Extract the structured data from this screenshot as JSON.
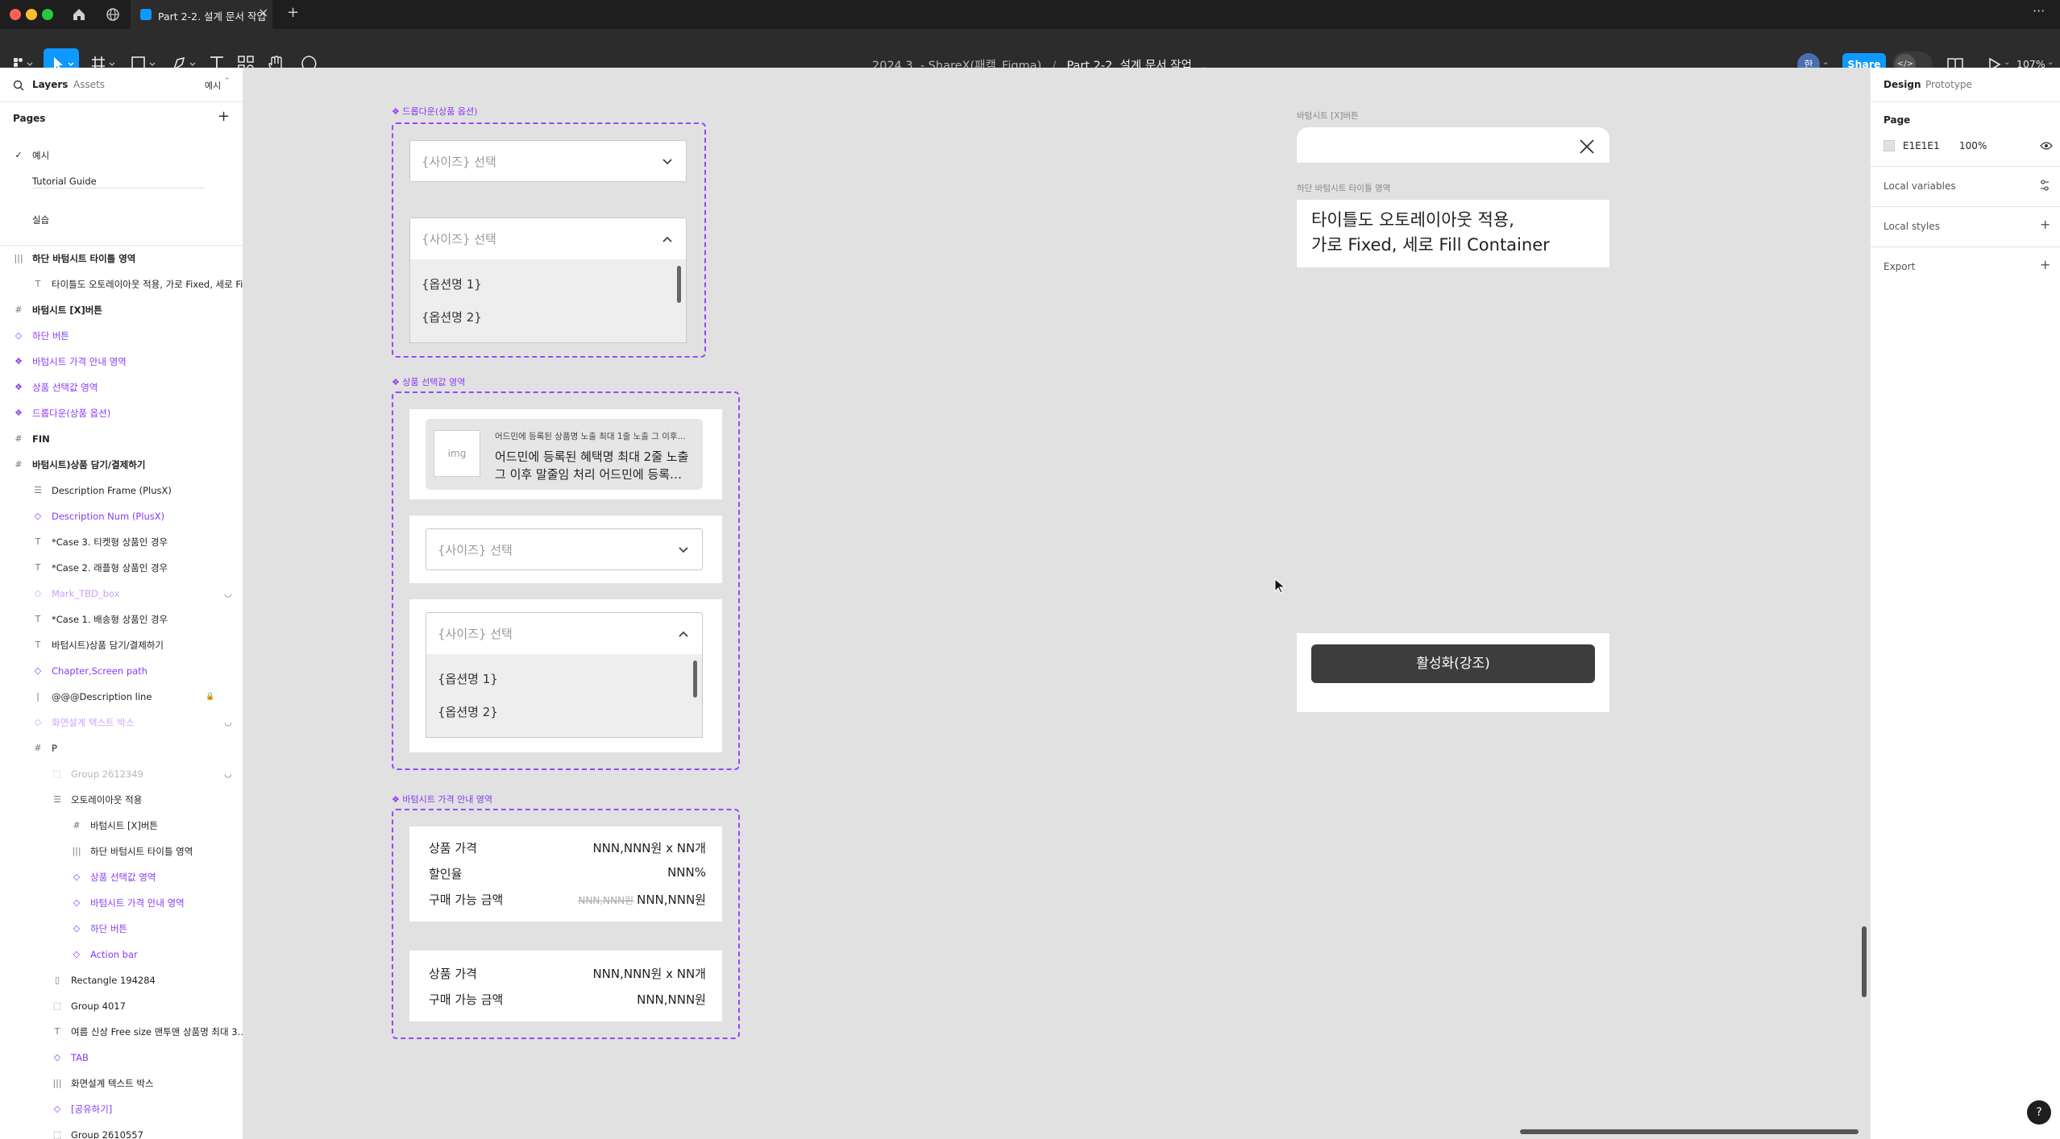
{
  "tabbar": {
    "tab_title": "Part 2-2. 설계 문서 작업",
    "more": "···"
  },
  "toolbar": {
    "breadcrumb_team": "2024.3. - ShareX(패캠_Figma)",
    "breadcrumb_sep": "/",
    "file_name": "Part 2-2. 설계 문서 작업",
    "avatar_initial": "한",
    "share_label": "Share",
    "zoom": "107%"
  },
  "left_panel": {
    "tabs": [
      "Layers",
      "Assets"
    ],
    "page_selector": "예시",
    "pages_title": "Pages",
    "pages": [
      {
        "label": "예시",
        "current": true
      },
      {
        "label": "Tutorial Guide",
        "current": false
      },
      {
        "label": "실습",
        "current": false
      }
    ],
    "layers": [
      {
        "label": "하단 바텀시트 타이틀 영역",
        "icon": "|||",
        "indent": 0,
        "style": "bold"
      },
      {
        "label": "타이틀도 오토레이아웃 적용, 가로 Fixed, 세로 Fil...",
        "icon": "T",
        "indent": 1,
        "style": ""
      },
      {
        "label": "바텀시트 [X]버튼",
        "icon": "#",
        "indent": 0,
        "style": "bold"
      },
      {
        "label": "하단 버튼",
        "icon": "◇",
        "indent": 0,
        "style": "purple"
      },
      {
        "label": "바텀시트 가격 안내 영역",
        "icon": "❖",
        "indent": 0,
        "style": "purple"
      },
      {
        "label": "상품 선택값 영역",
        "icon": "❖",
        "indent": 0,
        "style": "purple"
      },
      {
        "label": "드롭다운(상품 옵션)",
        "icon": "❖",
        "indent": 0,
        "style": "purple"
      },
      {
        "label": "FIN",
        "icon": "#",
        "indent": 0,
        "style": "bold"
      },
      {
        "label": "바텀시트)상품 담기/결제하기",
        "icon": "#",
        "indent": 0,
        "style": "bold"
      },
      {
        "label": "Description Frame (PlusX)",
        "icon": "☰",
        "indent": 1,
        "style": ""
      },
      {
        "label": "Description Num (PlusX)",
        "icon": "◇",
        "indent": 1,
        "style": "purple"
      },
      {
        "label": "*Case 3. 티켓형 상품인 경우",
        "icon": "T",
        "indent": 1,
        "style": ""
      },
      {
        "label": "*Case 2. 래플형 상품인 경우",
        "icon": "T",
        "indent": 1,
        "style": ""
      },
      {
        "label": "Mark_TBD_box",
        "icon": "◇",
        "indent": 1,
        "style": "faded-purple",
        "hidden": true
      },
      {
        "label": "*Case 1. 배송형 상품인 경우",
        "icon": "T",
        "indent": 1,
        "style": ""
      },
      {
        "label": "바텀시트)상품 담기/결제하기",
        "icon": "T",
        "indent": 1,
        "style": ""
      },
      {
        "label": "Chapter,Screen path",
        "icon": "◇",
        "indent": 1,
        "style": "purple"
      },
      {
        "label": "@@@Description line",
        "icon": "|",
        "indent": 1,
        "style": "",
        "locked": true
      },
      {
        "label": "화면설계 텍스트 박스",
        "icon": "◇",
        "indent": 1,
        "style": "faded-purple",
        "hidden": true
      },
      {
        "label": "P",
        "icon": "#",
        "indent": 1,
        "style": ""
      },
      {
        "label": "Group 2612349",
        "icon": "⬚",
        "indent": 2,
        "style": "faded",
        "hidden": true
      },
      {
        "label": "오토레이아웃 적용",
        "icon": "☰",
        "indent": 2,
        "style": ""
      },
      {
        "label": "바텀시트 [X]버튼",
        "icon": "#",
        "indent": 3,
        "style": ""
      },
      {
        "label": "하단 바텀시트 타이틀 영역",
        "icon": "|||",
        "indent": 3,
        "style": ""
      },
      {
        "label": "상품 선택값 영역",
        "icon": "◇",
        "indent": 3,
        "style": "purple"
      },
      {
        "label": "바텀시트 가격 안내 영역",
        "icon": "◇",
        "indent": 3,
        "style": "purple"
      },
      {
        "label": "하단 버튼",
        "icon": "◇",
        "indent": 3,
        "style": "purple"
      },
      {
        "label": "Action bar",
        "icon": "◇",
        "indent": 3,
        "style": "purple"
      },
      {
        "label": "Rectangle 194284",
        "icon": "▯",
        "indent": 2,
        "style": ""
      },
      {
        "label": "Group 4017",
        "icon": "⬚",
        "indent": 2,
        "style": ""
      },
      {
        "label": "여름 신상 Free size 맨투맨 상품명 최대 3...",
        "icon": "T",
        "indent": 2,
        "style": ""
      },
      {
        "label": "TAB",
        "icon": "◇",
        "indent": 2,
        "style": "purple"
      },
      {
        "label": "화면설계 텍스트 박스",
        "icon": "|||",
        "indent": 2,
        "style": ""
      },
      {
        "label": "[공유하기]",
        "icon": "◇",
        "indent": 2,
        "style": "purple"
      },
      {
        "label": "Group 2610557",
        "icon": "⬚",
        "indent": 2,
        "style": ""
      }
    ]
  },
  "canvas": {
    "dropdown_frame_label": "드롭다운(상품 옵션)",
    "select_placeholder": "{사이즈} 선택",
    "option_1": "{옵션명 1}",
    "option_2": "{옵션명 2}",
    "product_frame_label": "상품 선택값 영역",
    "img_label": "img",
    "product_small": "어드민에 등록된 상품명 노출 최대 1줄 노출 그 이후...",
    "product_line1": "어드민에 등록된 혜택명 최대 2줄 노출",
    "product_line2": "그 이후 말줄임 처리 어드민에 등록…",
    "price_frame_label": "바텀시트 가격 안내 영역",
    "price_label": "상품 가격",
    "price_value": "NNN,NNN원 x NN개",
    "discount_label": "할인율",
    "discount_value": "NNN%",
    "buy_label": "구매 가능 금액",
    "buy_strike": "NNN,NNN원",
    "buy_value": "NNN,NNN원",
    "sheet_x_label": "바텀시트 [X]버튼",
    "title_area_label": "하단 바텀시트 타이틀 영역",
    "title_line1": "타이틀도 오토레이아웃 적용,",
    "title_line2": "가로 Fixed, 세로 Fill Container",
    "cta_label": "활성화(강조)"
  },
  "right_panel": {
    "tabs": [
      "Design",
      "Prototype"
    ],
    "page_heading": "Page",
    "bg_hex": "E1E1E1",
    "bg_opacity": "100%",
    "local_variables": "Local variables",
    "local_styles": "Local styles",
    "export": "Export",
    "help": "?"
  },
  "colors": {
    "accent_blue": "#0d99ff",
    "component_purple": "#9747ff",
    "canvas_bg": "#e1e1e1",
    "cta_dark": "#3d3d3d"
  }
}
